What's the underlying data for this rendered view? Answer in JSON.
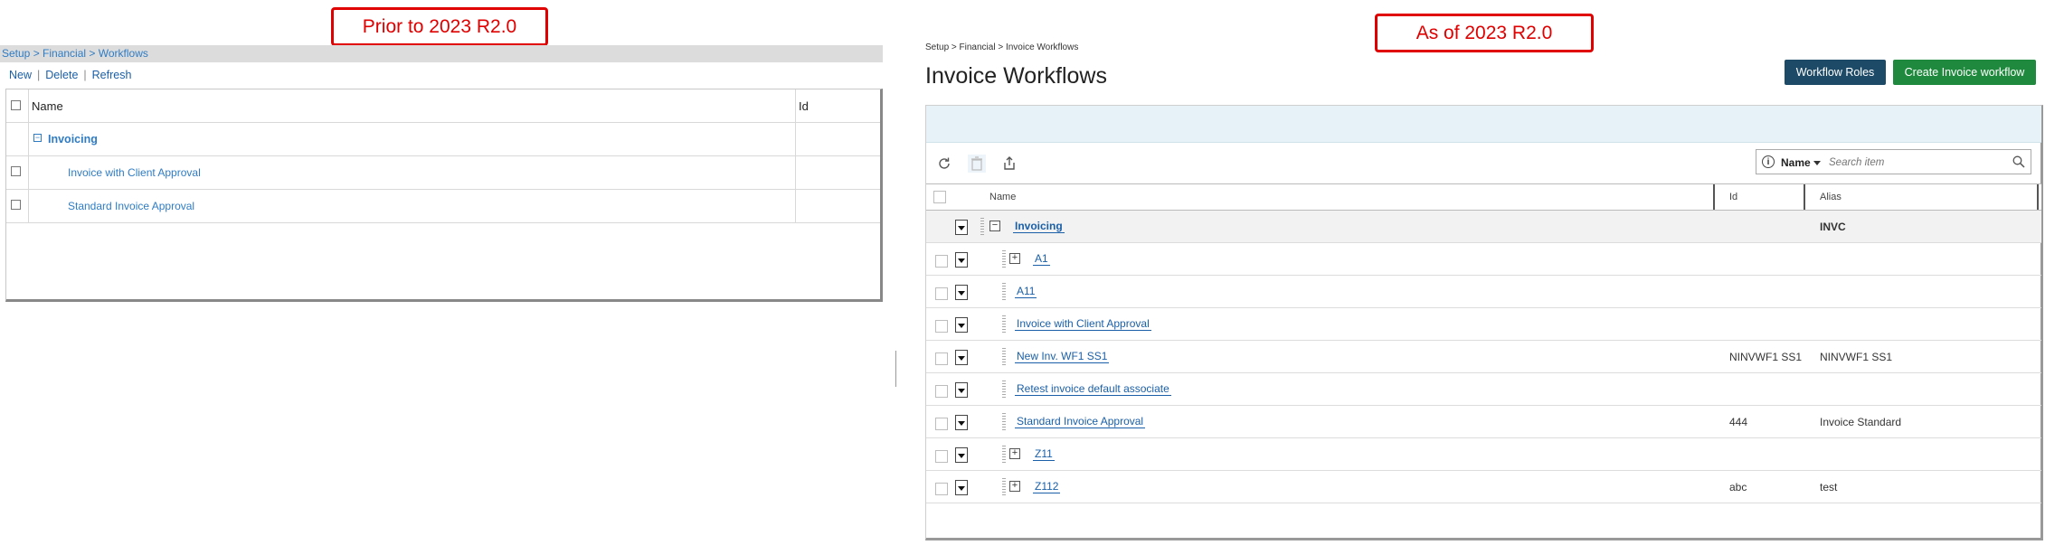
{
  "callouts": {
    "before": "Prior to 2023 R2.0",
    "after": "As of 2023 R2.0"
  },
  "old": {
    "breadcrumb": "Setup > Financial > Workflows",
    "actions": {
      "new": "New",
      "delete": "Delete",
      "refresh": "Refresh",
      "sep": "|"
    },
    "columns": {
      "name": "Name",
      "id": "Id"
    },
    "group": {
      "expander": "−",
      "label": "Invoicing"
    },
    "rows": [
      {
        "name": "Invoice with Client Approval"
      },
      {
        "name": "Standard Invoice Approval"
      }
    ]
  },
  "new": {
    "breadcrumb": "Setup > Financial > Invoice Workflows",
    "title": "Invoice Workflows",
    "buttons": {
      "roles": "Workflow Roles",
      "create": "Create Invoice workflow"
    },
    "search": {
      "field": "Name",
      "placeholder": "Search item",
      "info": "i"
    },
    "columns": {
      "name": "Name",
      "id": "Id",
      "alias": "Alias"
    },
    "group": {
      "expander": "−",
      "label": "Invoicing",
      "alias": "INVC"
    },
    "rows": [
      {
        "expander": "+",
        "name": "A1",
        "id": "",
        "alias": ""
      },
      {
        "expander": "",
        "name": "A11",
        "id": "",
        "alias": ""
      },
      {
        "expander": "",
        "name": "Invoice with Client Approval",
        "id": "",
        "alias": ""
      },
      {
        "expander": "",
        "name": "New Inv. WF1 SS1",
        "id": "NINVWF1 SS1",
        "alias": "NINVWF1 SS1"
      },
      {
        "expander": "",
        "name": "Retest invoice default associate",
        "id": "",
        "alias": ""
      },
      {
        "expander": "",
        "name": "Standard Invoice Approval",
        "id": "444",
        "alias": "Invoice Standard"
      },
      {
        "expander": "+",
        "name": "Z11",
        "id": "",
        "alias": ""
      },
      {
        "expander": "+",
        "name": "Z112",
        "id": "abc",
        "alias": "test"
      }
    ]
  },
  "colors": {
    "callout": "#e00000",
    "link": "#1a5fa8",
    "roles_button": "#1d4a66",
    "create_button": "#1f8a3d",
    "band": "#e6f2f8"
  },
  "icons": [
    "refresh-icon",
    "delete-icon",
    "export-icon",
    "info-icon",
    "search-icon",
    "chevron-down-icon"
  ]
}
